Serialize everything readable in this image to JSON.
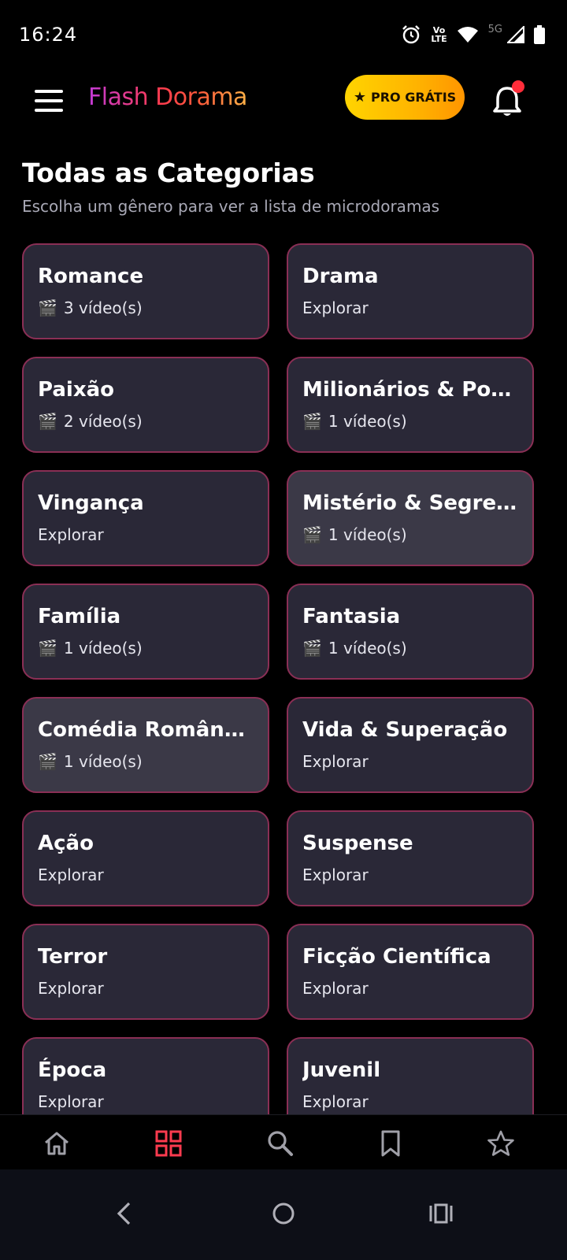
{
  "status": {
    "time": "16:24",
    "volte_line1": "Vo",
    "volte_line2": "LTE",
    "net": "5G"
  },
  "header": {
    "logo": "Flash Dorama",
    "pro_label": "PRO GRÁTIS",
    "pro_star": "★"
  },
  "page": {
    "title": "Todas as Categorias",
    "subtitle": "Escolha um gênero para ver a lista de microdoramas"
  },
  "categories": [
    {
      "name": "Romance",
      "info": "3 vídeo(s)",
      "icon": "🎬"
    },
    {
      "name": "Drama",
      "info": "Explorar",
      "icon": ""
    },
    {
      "name": "Paixão",
      "info": "2 vídeo(s)",
      "icon": "🎬"
    },
    {
      "name": "Milionários & Pod...",
      "info": "1 vídeo(s)",
      "icon": "🎬"
    },
    {
      "name": "Vingança",
      "info": "Explorar",
      "icon": ""
    },
    {
      "name": "Mistério & Segredos",
      "info": "1 vídeo(s)",
      "icon": "🎬"
    },
    {
      "name": "Família",
      "info": "1 vídeo(s)",
      "icon": "🎬"
    },
    {
      "name": "Fantasia",
      "info": "1 vídeo(s)",
      "icon": "🎬"
    },
    {
      "name": "Comédia Romântica",
      "info": "1 vídeo(s)",
      "icon": "🎬"
    },
    {
      "name": "Vida & Superação",
      "info": "Explorar",
      "icon": ""
    },
    {
      "name": "Ação",
      "info": "Explorar",
      "icon": ""
    },
    {
      "name": "Suspense",
      "info": "Explorar",
      "icon": ""
    },
    {
      "name": "Terror",
      "info": "Explorar",
      "icon": ""
    },
    {
      "name": "Ficção Científica",
      "info": "Explorar",
      "icon": ""
    },
    {
      "name": "Época",
      "info": "Explorar",
      "icon": ""
    },
    {
      "name": "Juvenil",
      "info": "Explorar",
      "icon": ""
    }
  ],
  "colors": {
    "accent": "#ff3b4f",
    "card_bg": "#2a2837",
    "card_border": "#8a2f55",
    "pro_gradient_start": "#ffd400",
    "pro_gradient_end": "#ff9500"
  },
  "nav": {
    "items": [
      "home-icon",
      "categories-icon",
      "search-icon",
      "bookmark-icon",
      "star-icon"
    ],
    "active": "categories-icon"
  }
}
